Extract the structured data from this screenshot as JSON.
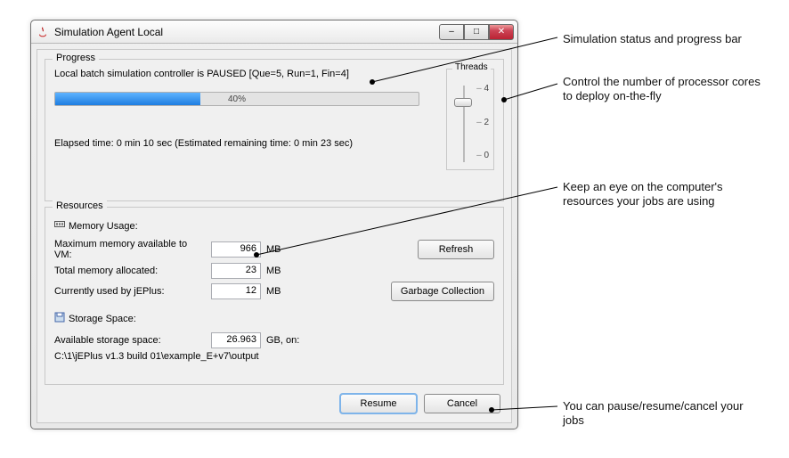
{
  "window": {
    "title": "Simulation Agent Local"
  },
  "progress": {
    "group_title": "Progress",
    "status_text": "Local batch simulation controller is PAUSED [Que=5, Run=1, Fin=4]",
    "percent_label": "40%",
    "percent_value": 40,
    "elapsed_text": "Elapsed time: 0 min 10 sec (Estimated remaining time: 0 min 23 sec)",
    "threads": {
      "title": "Threads",
      "ticks": [
        "4",
        "2",
        "0"
      ],
      "value": 3
    }
  },
  "resources": {
    "group_title": "Resources",
    "memory": {
      "section_label": "Memory Usage:",
      "rows": {
        "max_vm": {
          "label": "Maximum memory available to VM:",
          "value": "966",
          "unit": "MB"
        },
        "total_alloc": {
          "label": "Total memory allocated:",
          "value": "23",
          "unit": "MB"
        },
        "used": {
          "label": "Currently used by jEPlus:",
          "value": "12",
          "unit": "MB"
        }
      },
      "refresh_label": "Refresh",
      "gc_label": "Garbage Collection"
    },
    "storage": {
      "section_label": "Storage Space:",
      "avail": {
        "label": "Available storage space:",
        "value": "26.963",
        "unit": "GB, on:"
      },
      "path": "C:\\1\\jEPlus v1.3 build 01\\example_E+v7\\output"
    }
  },
  "buttons": {
    "resume": "Resume",
    "cancel": "Cancel"
  },
  "callouts": {
    "a": "Simulation status and progress bar",
    "b": "Control the number of processor cores to deploy on-the-fly",
    "c": "Keep an eye on the computer's resources your jobs are using",
    "d": "You can pause/resume/cancel your jobs"
  }
}
